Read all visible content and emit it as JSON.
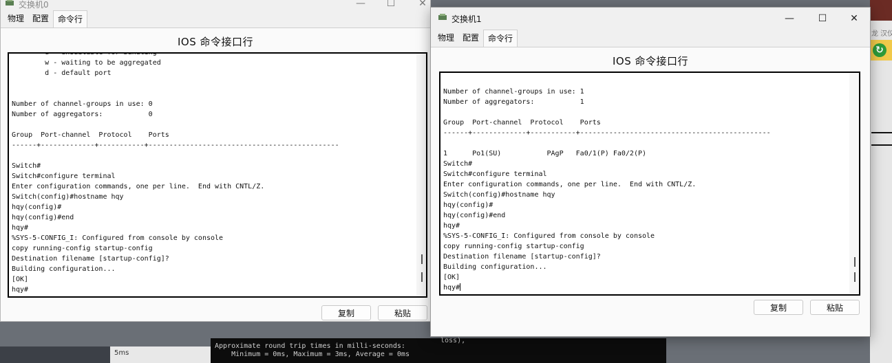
{
  "background": {
    "terminal_lines": [
      "Approximate round trip times in milli-seconds:",
      "    Minimum = 0ms, Maximum = 3ms, Average = 0ms"
    ],
    "terminal_right_fragment": "loss),",
    "left_label": "5ms",
    "right_text": "龙 汉仪"
  },
  "windows": [
    {
      "title": "交换机0",
      "controls": {
        "minimize": "—",
        "maximize": "☐",
        "close": "✕"
      },
      "tabs": [
        {
          "label": "物理",
          "active": false
        },
        {
          "label": "配置",
          "active": false
        },
        {
          "label": "命令行",
          "active": true
        }
      ],
      "heading": "IOS 命令接口行",
      "console_lines": [
        "        u - unsuitable for bundling",
        "        w - waiting to be aggregated",
        "        d - default port",
        "",
        "",
        "Number of channel-groups in use: 0",
        "Number of aggregators:           0",
        "",
        "Group  Port-channel  Protocol    Ports",
        "------+-------------+-----------+----------------------------------------------",
        "",
        "Switch#",
        "Switch#configure terminal",
        "Enter configuration commands, one per line.  End with CNTL/Z.",
        "Switch(config)#hostname hqy",
        "hqy(config)#",
        "hqy(config)#end",
        "hqy#",
        "%SYS-5-CONFIG_I: Configured from console by console",
        "copy running-config startup-config",
        "Destination filename [startup-config]?",
        "Building configuration...",
        "[OK]",
        "hqy#"
      ],
      "buttons": {
        "copy": "复制",
        "paste": "粘贴"
      }
    },
    {
      "title": "交换机1",
      "controls": {
        "minimize": "—",
        "maximize": "☐",
        "close": "✕"
      },
      "tabs": [
        {
          "label": "物理",
          "active": false
        },
        {
          "label": "配置",
          "active": false
        },
        {
          "label": "命令行",
          "active": true
        }
      ],
      "heading": "IOS 命令接口行",
      "console_lines": [
        "Number of channel-groups in use: 1",
        "Number of aggregators:           1",
        "",
        "Group  Port-channel  Protocol    Ports",
        "------+-------------+-----------+----------------------------------------------",
        "",
        "1      Po1(SU)           PAgP   Fa0/1(P) Fa0/2(P)",
        "Switch#",
        "Switch#configure terminal",
        "Enter configuration commands, one per line.  End with CNTL/Z.",
        "Switch(config)#hostname hqy",
        "hqy(config)#",
        "hqy(config)#end",
        "hqy#",
        "%SYS-5-CONFIG_I: Configured from console by console",
        "copy running-config startup-config",
        "Destination filename [startup-config]?",
        "Building configuration...",
        "[OK]",
        "hqy#"
      ],
      "buttons": {
        "copy": "复制",
        "paste": "粘贴"
      }
    }
  ]
}
